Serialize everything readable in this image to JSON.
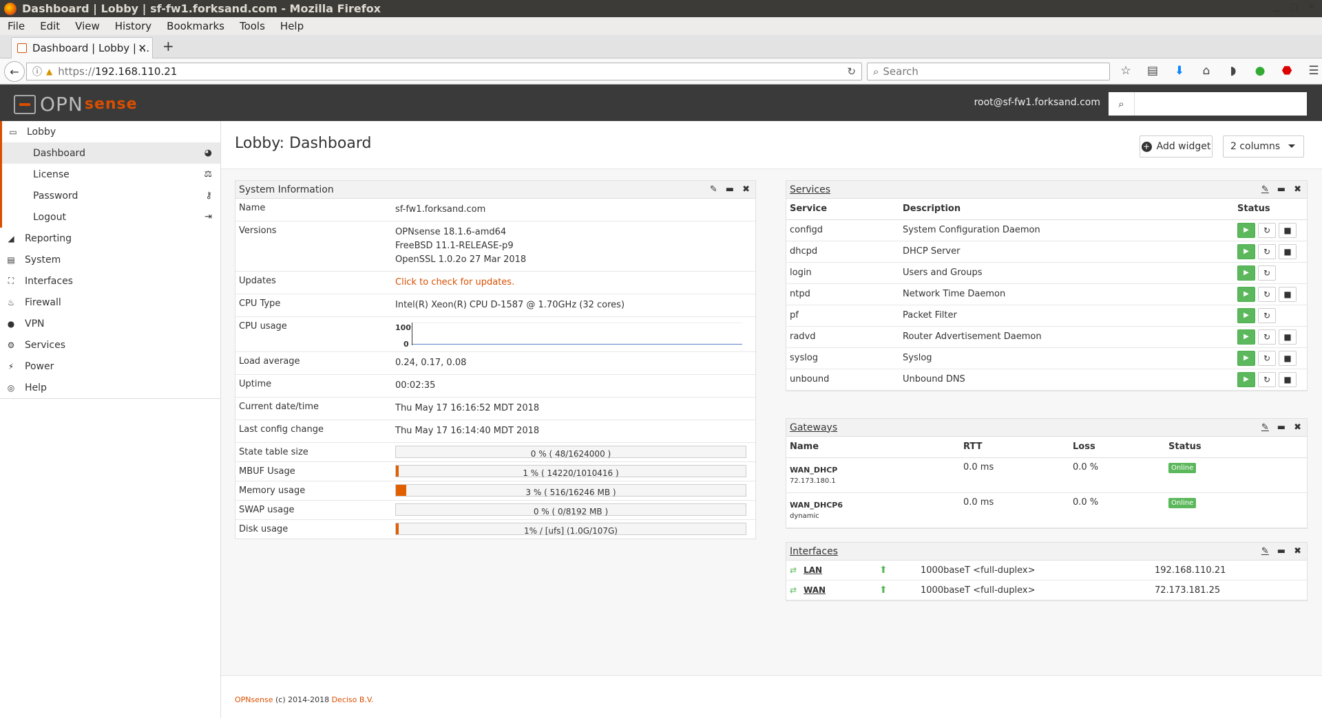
{
  "window": {
    "title": "Dashboard | Lobby | sf-fw1.forksand.com - Mozilla Firefox"
  },
  "menu": [
    "File",
    "Edit",
    "View",
    "History",
    "Bookmarks",
    "Tools",
    "Help"
  ],
  "tab": {
    "title": "Dashboard | Lobby | ..."
  },
  "url": {
    "protocol": "https://",
    "host": "192.168.110.21"
  },
  "browser_search": {
    "placeholder": "Search"
  },
  "header": {
    "logo_main": "OPN",
    "logo_sense": "sense",
    "user": "root@sf-fw1.forksand.com"
  },
  "sidebar": {
    "lobby": "Lobby",
    "lobby_items": [
      {
        "label": "Dashboard",
        "icon": "dashboard-icon"
      },
      {
        "label": "License",
        "icon": "scale-icon"
      },
      {
        "label": "Password",
        "icon": "key-icon"
      },
      {
        "label": "Logout",
        "icon": "logout-icon"
      }
    ],
    "items": [
      "Reporting",
      "System",
      "Interfaces",
      "Firewall",
      "VPN",
      "Services",
      "Power",
      "Help"
    ]
  },
  "page": {
    "title": "Lobby: Dashboard",
    "add_widget": "Add widget",
    "columns": "2 columns"
  },
  "sysinfo": {
    "title": "System Information",
    "name_k": "Name",
    "name_v": "sf-fw1.forksand.com",
    "versions_k": "Versions",
    "versions_v1": "OPNsense 18.1.6-amd64",
    "versions_v2": "FreeBSD 11.1-RELEASE-p9",
    "versions_v3": "OpenSSL 1.0.2o 27 Mar 2018",
    "updates_k": "Updates",
    "updates_v": "Click to check for updates.",
    "cputype_k": "CPU Type",
    "cputype_v": "Intel(R) Xeon(R) CPU D-1587 @ 1.70GHz (32 cores)",
    "cpuusage_k": "CPU usage",
    "cpu_max": "100",
    "cpu_min": "0",
    "load_k": "Load average",
    "load_v": "0.24, 0.17, 0.08",
    "uptime_k": "Uptime",
    "uptime_v": "00:02:35",
    "date_k": "Current date/time",
    "date_v": "Thu May 17 16:16:52 MDT 2018",
    "cfg_k": "Last config change",
    "cfg_v": "Thu May 17 16:14:40 MDT 2018",
    "state_k": "State table size",
    "state_v": "0 % ( 48/1624000 )",
    "state_pct": 0,
    "mbuf_k": "MBUF Usage",
    "mbuf_v": "1 % ( 14220/1010416 )",
    "mbuf_pct": 1,
    "mem_k": "Memory usage",
    "mem_v": "3 % ( 516/16246 MB )",
    "mem_pct": 3,
    "swap_k": "SWAP usage",
    "swap_v": "0 % ( 0/8192 MB )",
    "swap_pct": 0,
    "disk_k": "Disk usage",
    "disk_v": "1% / [ufs] (1.0G/107G)",
    "disk_pct": 1
  },
  "services": {
    "title": "Services",
    "headers": [
      "Service",
      "Description",
      "Status"
    ],
    "rows": [
      {
        "name": "configd",
        "desc": "System Configuration Daemon"
      },
      {
        "name": "dhcpd",
        "desc": "DHCP Server"
      },
      {
        "name": "login",
        "desc": "Users and Groups"
      },
      {
        "name": "ntpd",
        "desc": "Network Time Daemon"
      },
      {
        "name": "pf",
        "desc": "Packet Filter"
      },
      {
        "name": "radvd",
        "desc": "Router Advertisement Daemon"
      },
      {
        "name": "syslog",
        "desc": "Syslog"
      },
      {
        "name": "unbound",
        "desc": "Unbound DNS"
      }
    ]
  },
  "gateways": {
    "title": "Gateways",
    "headers": [
      "Name",
      "RTT",
      "Loss",
      "Status"
    ],
    "rows": [
      {
        "name": "WAN_DHCP",
        "addr": "72.173.180.1",
        "rtt": "0.0 ms",
        "loss": "0.0 %",
        "status": "Online"
      },
      {
        "name": "WAN_DHCP6",
        "addr": "dynamic",
        "rtt": "0.0 ms",
        "loss": "0.0 %",
        "status": "Online"
      }
    ]
  },
  "interfaces": {
    "title": "Interfaces",
    "rows": [
      {
        "name": "LAN",
        "media": "1000baseT <full-duplex>",
        "ip": "192.168.110.21"
      },
      {
        "name": "WAN",
        "media": "1000baseT <full-duplex>",
        "ip": "72.173.181.25"
      }
    ]
  },
  "footer": {
    "brand": "OPNsense",
    "copy": " (c) 2014-2018 ",
    "company": "Deciso B.V."
  }
}
